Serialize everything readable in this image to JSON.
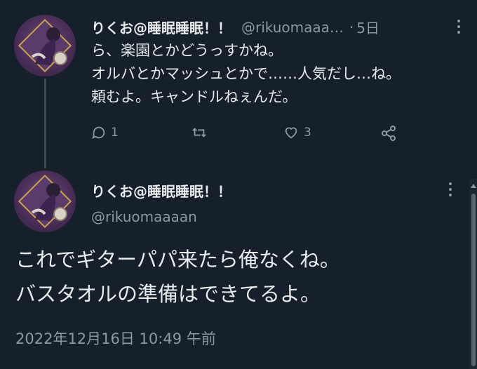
{
  "reply": {
    "display_name": "りくお@睡眠睡眠！！",
    "handle": "@rikuomaaa…",
    "separator": "·",
    "time": "5日",
    "text_lines": [
      "ら、楽園とかどうっすかね。",
      "オルバとかマッシュとかで……人気だし…ね。",
      "頼むよ。キャンドルねぇんだ。"
    ],
    "reply_count": "1",
    "retweet_count": "",
    "like_count": "3",
    "icons": [
      "reply-icon",
      "retweet-icon",
      "like-icon",
      "share-icon",
      "more-icon"
    ]
  },
  "main_tweet": {
    "display_name": "りくお@睡眠睡眠！！",
    "handle": "@rikuomaaaan",
    "text_lines": [
      "これでギターパパ来たら俺なくね。",
      "バスタオルの準備はできてるよ。"
    ],
    "timestamp": "2022年12月16日 10:49 午前"
  },
  "colors": {
    "background": "#15202b",
    "primary_text": "#e7e9ea",
    "secondary_text": "#8b98a5",
    "thread_line": "#3d4b58",
    "avatar_purple": "#4b2f5a"
  }
}
